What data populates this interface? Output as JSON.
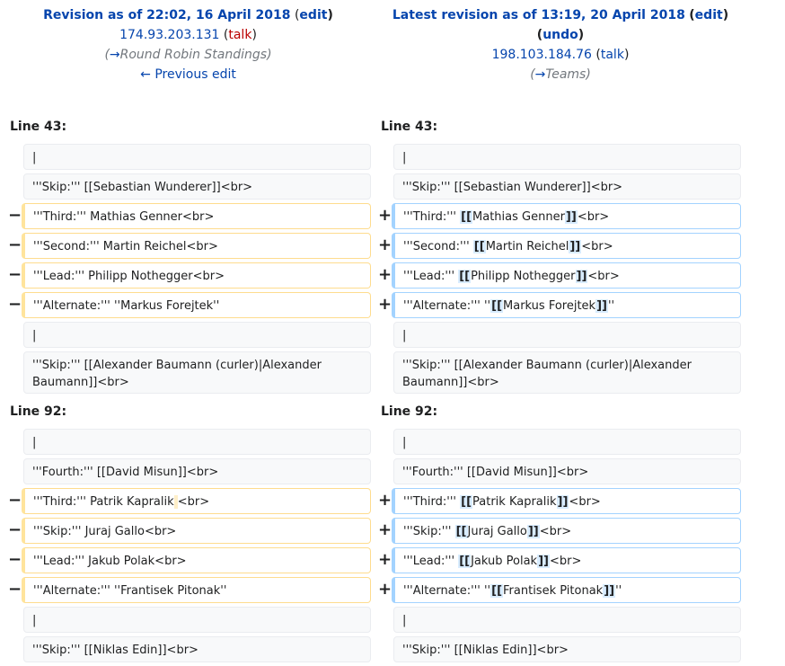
{
  "left_header": {
    "title": "Revision as of 22:02, 16 April 2018",
    "edit": "edit",
    "user": "174.93.203.131",
    "talk": "talk",
    "summary_arrow": "→",
    "summary": "Round Robin Standings",
    "prev": "← Previous edit"
  },
  "right_header": {
    "title": "Latest revision as of 13:19, 20 April 2018",
    "edit": "edit",
    "undo": "undo",
    "user": "198.103.184.76",
    "talk": "talk",
    "summary_arrow": "→",
    "summary": "Teams"
  },
  "markers": {
    "minus": "−",
    "plus": "+"
  },
  "sections": [
    {
      "line_label": "Line 43:",
      "rows": [
        {
          "left": "|",
          "right": "|"
        },
        {
          "left": "'''Skip:''' [[Sebastian Wunderer]]<br>",
          "right": "'''Skip:''' [[Sebastian Wunderer]]<br>"
        },
        {
          "left": "'''Third:''' Mathias Genner<br>",
          "r_pre": "'''Third:''' ",
          "r_hl1": "[[",
          "r_mid": "Mathias Genner",
          "r_hl2": "]]",
          "r_post": "<br>"
        },
        {
          "left": "'''Second:''' Martin Reichel<br>",
          "r_pre": "'''Second:''' ",
          "r_hl1": "[[",
          "r_mid": "Martin Reichel",
          "r_hl2": "]]",
          "r_post": "<br>"
        },
        {
          "left": "'''Lead:''' Philipp Nothegger<br>",
          "r_pre": "'''Lead:''' ",
          "r_hl1": "[[",
          "r_mid": "Philipp Nothegger",
          "r_hl2": "]]",
          "r_post": "<br>"
        },
        {
          "left": "'''Alternate:''' ''Markus Forejtek''",
          "r_pre": "'''Alternate:''' ''",
          "r_hl1": "[[",
          "r_mid": "Markus Forejtek",
          "r_hl2": "]]",
          "r_post": "''"
        },
        {
          "left": "|",
          "right": "|"
        },
        {
          "left": "'''Skip:''' [[Alexander Baumann (curler)|Alexander Baumann]]<br>",
          "right": "'''Skip:''' [[Alexander Baumann (curler)|Alexander Baumann]]<br>"
        }
      ]
    },
    {
      "line_label": "Line 92:",
      "rows": [
        {
          "left": "|",
          "right": "|"
        },
        {
          "left": "'''Fourth:''' [[David Misun]]<br>",
          "right": "'''Fourth:''' [[David Misun]]<br>"
        },
        {
          "left": "'''Third:''' Patrik Kapralik",
          "left_hl": " ",
          "left_post": "<br>",
          "r_pre": "'''Third:''' ",
          "r_hl1": "[[",
          "r_mid": "Patrik Kapralik",
          "r_hl2": "]]",
          "r_post": "<br>"
        },
        {
          "left": "'''Skip:''' Juraj Gallo<br>",
          "r_pre": "'''Skip:''' ",
          "r_hl1": "[[",
          "r_mid": "Juraj Gallo",
          "r_hl2": "]]",
          "r_post": "<br>"
        },
        {
          "left": "'''Lead:''' Jakub Polak<br>",
          "r_pre": "'''Lead:''' ",
          "r_hl1": "[[",
          "r_mid": "Jakub Polak",
          "r_hl2": "]]",
          "r_post": "<br>"
        },
        {
          "left": "'''Alternate:''' ''Frantisek Pitonak''",
          "r_pre": "'''Alternate:''' ''",
          "r_hl1": "[[",
          "r_mid": "Frantisek Pitonak",
          "r_hl2": "]]",
          "r_post": "''"
        },
        {
          "left": "|",
          "right": "|"
        },
        {
          "left": "'''Skip:''' [[Niklas Edin]]<br>",
          "right": "'''Skip:''' [[Niklas Edin]]<br>"
        }
      ]
    }
  ]
}
